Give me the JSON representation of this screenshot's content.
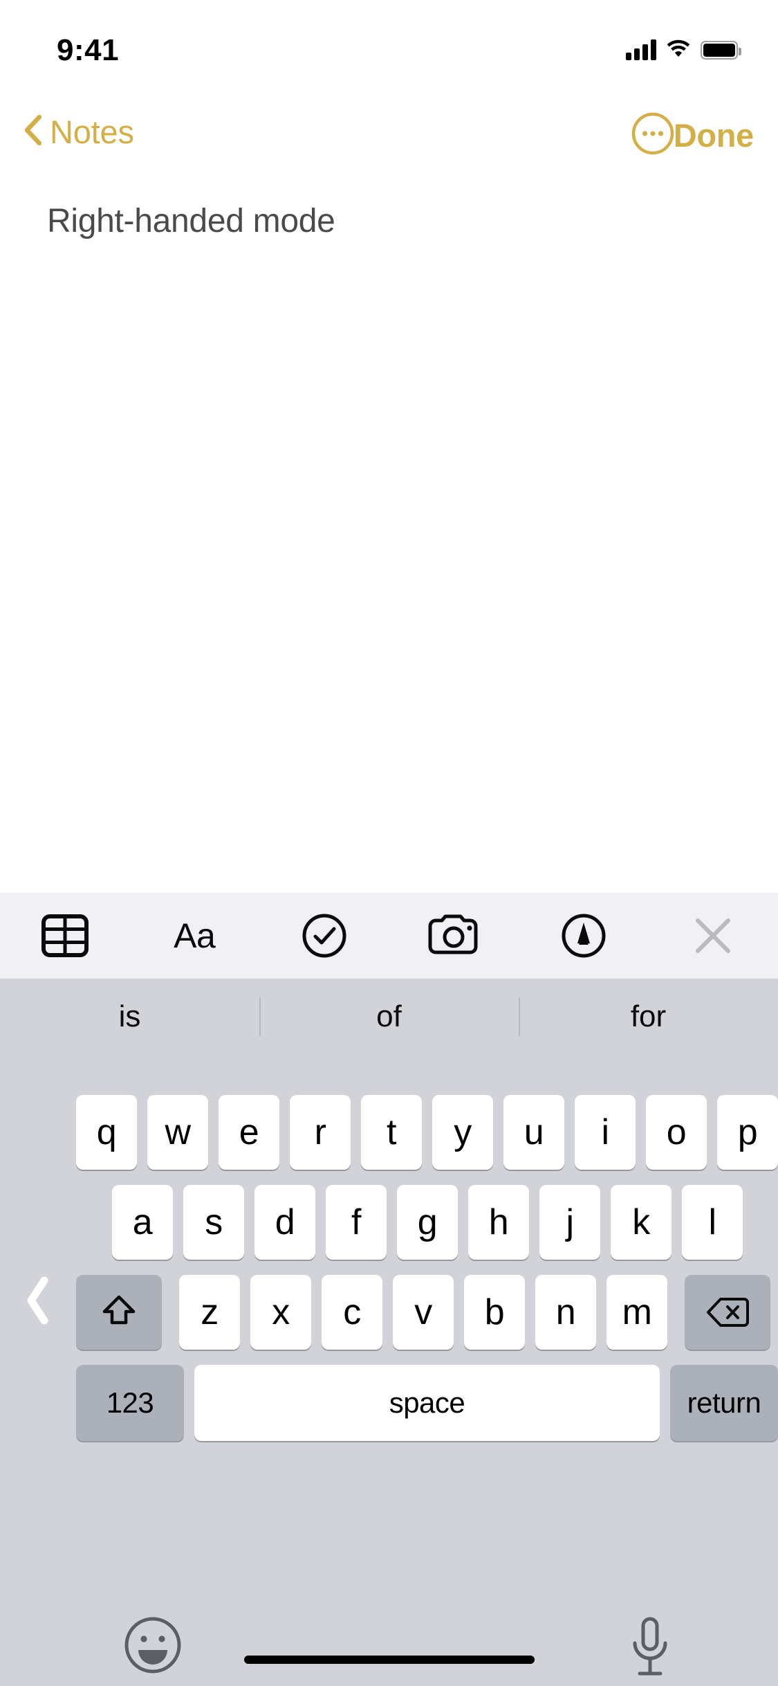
{
  "status_bar": {
    "time": "9:41",
    "cellular_icon": "signal-bars-icon",
    "wifi_icon": "wifi-icon",
    "battery_icon": "battery-full-icon"
  },
  "nav_bar": {
    "back_icon": "chevron-left-icon",
    "back_label": "Notes",
    "more_icon": "ellipsis-circle-icon",
    "done_label": "Done",
    "accent_color": "#D4AF45"
  },
  "note": {
    "body": "Right-handed mode",
    "text_color": "#4A4A4A"
  },
  "notes_toolbar": {
    "background": "#F1F1F5",
    "items": [
      {
        "name": "table-icon",
        "label": ""
      },
      {
        "name": "text-format-icon",
        "label": "Aa"
      },
      {
        "name": "checklist-icon",
        "label": ""
      },
      {
        "name": "camera-icon",
        "label": ""
      },
      {
        "name": "markup-pen-icon",
        "label": ""
      },
      {
        "name": "close-icon",
        "label": ""
      }
    ]
  },
  "keyboard": {
    "background": "#D1D3D9",
    "key_color": "#FFFFFF",
    "modifier_key_color": "#ACB0B9",
    "layout_mode": "right-handed-one-handed",
    "expand_handle_icon": "chevron-left-icon",
    "predictions": [
      "is",
      "of",
      "for"
    ],
    "row1": [
      "q",
      "w",
      "e",
      "r",
      "t",
      "y",
      "u",
      "i",
      "o",
      "p"
    ],
    "row2": [
      "a",
      "s",
      "d",
      "f",
      "g",
      "h",
      "j",
      "k",
      "l"
    ],
    "row3_letters": [
      "z",
      "x",
      "c",
      "v",
      "b",
      "n",
      "m"
    ],
    "shift_icon": "shift-arrow-icon",
    "backspace_icon": "delete-backward-icon",
    "numbers_label": "123",
    "space_label": "space",
    "return_label": "return",
    "emoji_icon": "emoji-smiley-icon",
    "dictation_icon": "microphone-icon"
  },
  "home_indicator": {
    "name": "home-indicator"
  }
}
